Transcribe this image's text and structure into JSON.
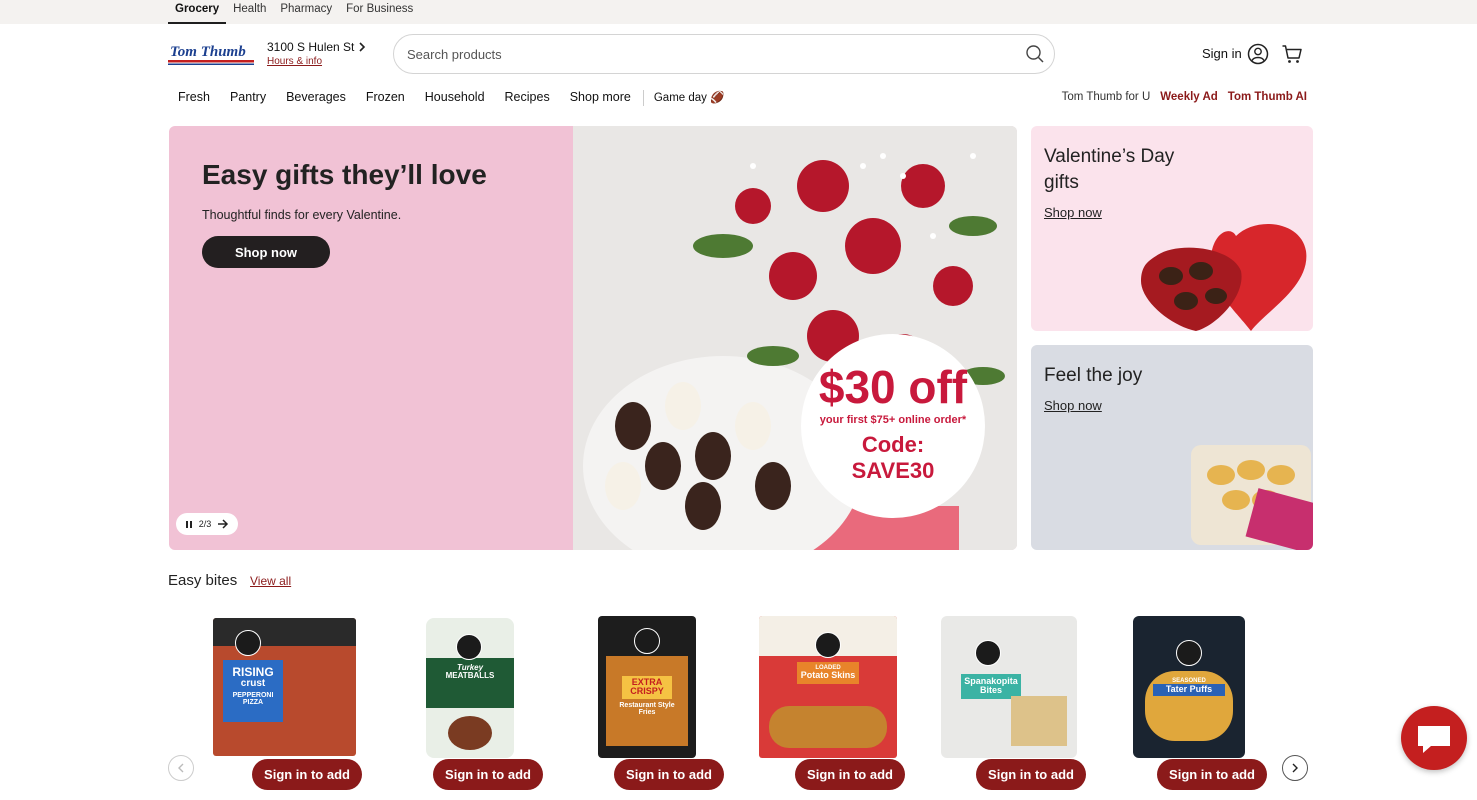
{
  "top_tabs": [
    "Grocery",
    "Health",
    "Pharmacy",
    "For Business"
  ],
  "store": {
    "address": "3100 S Hulen St",
    "hours_link": "Hours & info"
  },
  "search": {
    "placeholder": "Search products"
  },
  "account": {
    "sign_in": "Sign in"
  },
  "nav": {
    "items": [
      "Fresh",
      "Pantry",
      "Beverages",
      "Frozen",
      "Household",
      "Recipes",
      "Shop more"
    ],
    "game_day": "Game day 🏈",
    "right": [
      "Tom Thumb for U",
      "Weekly Ad",
      "Tom Thumb AI"
    ]
  },
  "hero": {
    "title": "Easy gifts they’ll love",
    "subtitle": "Thoughtful finds for every Valentine.",
    "button": "Shop now",
    "slide": "2/3",
    "offer": {
      "amount": "$30 off",
      "detail": "your first $75+ online order*",
      "code_label": "Code:",
      "code": "SAVE30"
    }
  },
  "promos": [
    {
      "title": "Valentine’s Day gifts",
      "link": "Shop now"
    },
    {
      "title": "Feel the joy",
      "link": "Shop now"
    }
  ],
  "bites": {
    "title": "Easy bites",
    "view_all": "View all",
    "button_label": "Sign in to add",
    "products": [
      {
        "line1": "RISING",
        "line2": "crust",
        "line3": "PEPPERONI PIZZA"
      },
      {
        "line1": "Turkey",
        "line2": "MEATBALLS",
        "line3": ""
      },
      {
        "line1": "EXTRA",
        "line2": "CRISPY",
        "line3": "Restaurant Style Fries"
      },
      {
        "line1": "LOADED",
        "line2": "Potato Skins",
        "line3": ""
      },
      {
        "line1": "Spanakopita",
        "line2": "Bites",
        "line3": ""
      },
      {
        "line1": "SEASONED",
        "line2": "Tater Puffs",
        "line3": ""
      }
    ]
  },
  "colors": {
    "accent": "#8b1a1a",
    "hero_bg": "#f1c2d5",
    "chat": "#c41f1f"
  }
}
